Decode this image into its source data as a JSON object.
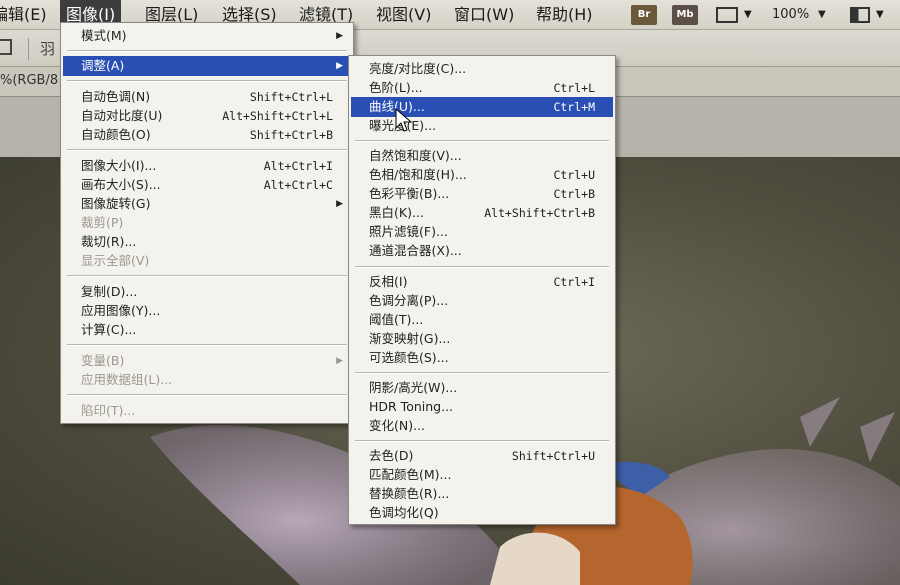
{
  "menubar": {
    "items": [
      {
        "label": "编辑(E)",
        "active": false
      },
      {
        "label": "图像(I)",
        "active": true
      },
      {
        "label": "图层(L)",
        "active": false
      },
      {
        "label": "选择(S)",
        "active": false
      },
      {
        "label": "滤镜(T)",
        "active": false
      },
      {
        "label": "视图(V)",
        "active": false
      },
      {
        "label": "窗口(W)",
        "active": false
      },
      {
        "label": "帮助(H)",
        "active": false
      }
    ],
    "br_label": "Br",
    "mb_label": "Mb",
    "zoom": "100%"
  },
  "optbar": {
    "label": "羽"
  },
  "doctab": {
    "label": "%(RGB/8"
  },
  "image_menu": {
    "items": [
      {
        "label": "模式(M)",
        "shortcut": "",
        "submenu": true,
        "disabled": false
      },
      {
        "sep": true
      },
      {
        "label": "调整(A)",
        "shortcut": "",
        "submenu": true,
        "disabled": false,
        "highlight": true
      },
      {
        "sep": true
      },
      {
        "label": "自动色调(N)",
        "shortcut": "Shift+Ctrl+L",
        "disabled": false
      },
      {
        "label": "自动对比度(U)",
        "shortcut": "Alt+Shift+Ctrl+L",
        "disabled": false
      },
      {
        "label": "自动颜色(O)",
        "shortcut": "Shift+Ctrl+B",
        "disabled": false
      },
      {
        "sep": true
      },
      {
        "label": "图像大小(I)...",
        "shortcut": "Alt+Ctrl+I",
        "disabled": false
      },
      {
        "label": "画布大小(S)...",
        "shortcut": "Alt+Ctrl+C",
        "disabled": false
      },
      {
        "label": "图像旋转(G)",
        "shortcut": "",
        "submenu": true,
        "disabled": false
      },
      {
        "label": "裁剪(P)",
        "shortcut": "",
        "disabled": true
      },
      {
        "label": "裁切(R)...",
        "shortcut": "",
        "disabled": false
      },
      {
        "label": "显示全部(V)",
        "shortcut": "",
        "disabled": true
      },
      {
        "sep": true
      },
      {
        "label": "复制(D)...",
        "shortcut": "",
        "disabled": false
      },
      {
        "label": "应用图像(Y)...",
        "shortcut": "",
        "disabled": false
      },
      {
        "label": "计算(C)...",
        "shortcut": "",
        "disabled": false
      },
      {
        "sep": true
      },
      {
        "label": "变量(B)",
        "shortcut": "",
        "submenu": true,
        "disabled": true
      },
      {
        "label": "应用数据组(L)...",
        "shortcut": "",
        "disabled": true
      },
      {
        "sep": true
      },
      {
        "label": "陷印(T)...",
        "shortcut": "",
        "disabled": true
      }
    ]
  },
  "adjust_menu": {
    "items": [
      {
        "label": "亮度/对比度(C)...",
        "shortcut": ""
      },
      {
        "label": "色阶(L)...",
        "shortcut": "Ctrl+L"
      },
      {
        "label": "曲线(U)...",
        "shortcut": "Ctrl+M",
        "highlight": true
      },
      {
        "label": "曝光度(E)...",
        "shortcut": ""
      },
      {
        "sep": true
      },
      {
        "label": "自然饱和度(V)...",
        "shortcut": ""
      },
      {
        "label": "色相/饱和度(H)...",
        "shortcut": "Ctrl+U"
      },
      {
        "label": "色彩平衡(B)...",
        "shortcut": "Ctrl+B"
      },
      {
        "label": "黑白(K)...",
        "shortcut": "Alt+Shift+Ctrl+B"
      },
      {
        "label": "照片滤镜(F)...",
        "shortcut": ""
      },
      {
        "label": "通道混合器(X)...",
        "shortcut": ""
      },
      {
        "sep": true
      },
      {
        "label": "反相(I)",
        "shortcut": "Ctrl+I"
      },
      {
        "label": "色调分离(P)...",
        "shortcut": ""
      },
      {
        "label": "阈值(T)...",
        "shortcut": ""
      },
      {
        "label": "渐变映射(G)...",
        "shortcut": ""
      },
      {
        "label": "可选颜色(S)...",
        "shortcut": ""
      },
      {
        "sep": true
      },
      {
        "label": "阴影/高光(W)...",
        "shortcut": ""
      },
      {
        "label": "HDR Toning...",
        "shortcut": ""
      },
      {
        "label": "变化(N)...",
        "shortcut": ""
      },
      {
        "sep": true
      },
      {
        "label": "去色(D)",
        "shortcut": "Shift+Ctrl+U"
      },
      {
        "label": "匹配颜色(M)...",
        "shortcut": ""
      },
      {
        "label": "替换颜色(R)...",
        "shortcut": ""
      },
      {
        "label": "色调均化(Q)",
        "shortcut": ""
      }
    ]
  },
  "colors": {
    "highlight": "#2a4fb4",
    "menu_bg": "#f3f2ec"
  }
}
